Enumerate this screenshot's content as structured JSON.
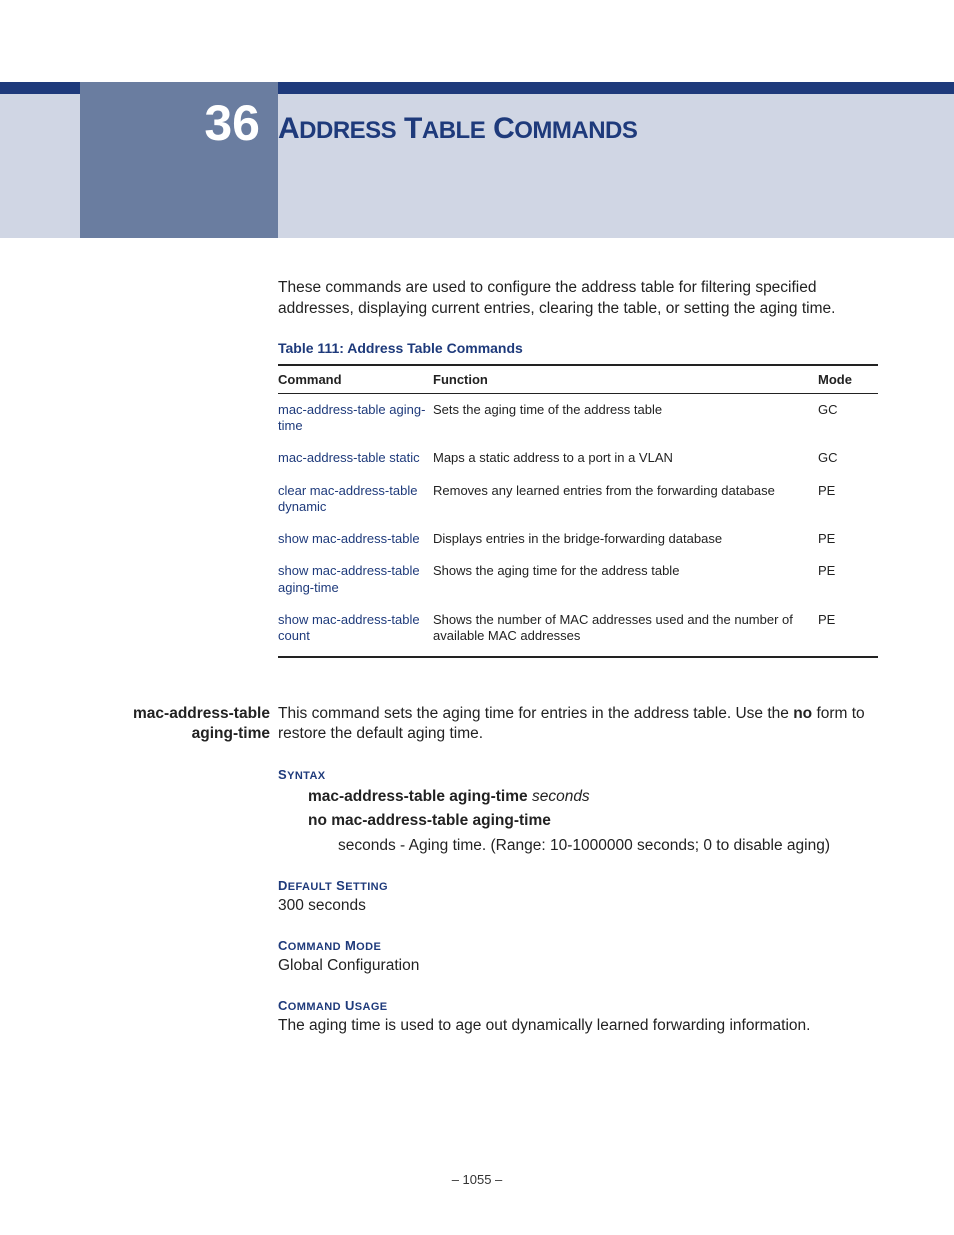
{
  "chapter": {
    "number": "36",
    "title_prefix": "A",
    "title_rest": "DDRESS",
    "title_prefix2": "T",
    "title_rest2": "ABLE",
    "title_prefix3": "C",
    "title_rest3": "OMMANDS"
  },
  "intro": "These commands are used to configure the address table for filtering specified addresses, displaying current entries, clearing the table, or setting the aging time.",
  "table": {
    "caption": "Table 111: Address Table Commands",
    "headers": {
      "c1": "Command",
      "c2": "Function",
      "c3": "Mode"
    },
    "rows": [
      {
        "cmd": "mac-address-table aging-time",
        "func": "Sets the aging time of the address table",
        "mode": "GC"
      },
      {
        "cmd": "mac-address-table static",
        "func": "Maps a static address to a port in a VLAN",
        "mode": "GC"
      },
      {
        "cmd": "clear mac-address-table dynamic",
        "func": "Removes any learned entries from the forwarding database",
        "mode": "PE"
      },
      {
        "cmd": "show mac-address-table",
        "func": "Displays entries in the bridge-forwarding database",
        "mode": "PE"
      },
      {
        "cmd": "show mac-address-table aging-time",
        "func": "Shows the aging time for the address table",
        "mode": "PE"
      },
      {
        "cmd": "show mac-address-table count",
        "func": "Shows the number of MAC addresses used and the number of available MAC addresses",
        "mode": "PE"
      }
    ]
  },
  "section": {
    "side": "mac-address-table aging-time",
    "lead": "This command sets the aging time for entries in the address table. Use the ",
    "lead_bold": "no",
    "lead_tail": " form to restore the default aging time.",
    "syntax_h": "SYNTAX",
    "syntax_cmd1_b": "mac-address-table aging-time ",
    "syntax_cmd1_i": "seconds",
    "syntax_cmd2_b": "no mac-address-table aging-time",
    "param_i": "seconds",
    "param_rest": " - Aging time. (Range: 10-1000000 seconds; 0 to disable aging)",
    "default_h": "DEFAULT SETTING",
    "default_body": "300 seconds",
    "mode_h": "COMMAND MODE",
    "mode_body": "Global Configuration",
    "usage_h": "COMMAND USAGE",
    "usage_body": "The aging time is used to age out dynamically learned forwarding information."
  },
  "pagenum": "–  1055  –"
}
